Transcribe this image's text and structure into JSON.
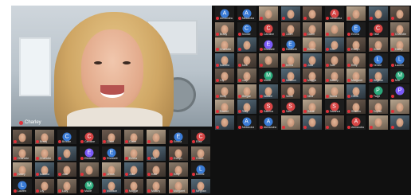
{
  "speaker": {
    "name": "Charley"
  },
  "colors": {
    "mic_muted": "#e0313a",
    "grid_bg": "#101010"
  },
  "tiles": [
    {
      "label": "Alexandra",
      "avatar": "A",
      "color": "#3a7bd5"
    },
    {
      "label": "Alexandra",
      "avatar": "A",
      "color": "#3a7bd5"
    },
    {
      "label": "",
      "avatar": "",
      "color": ""
    },
    {
      "label": "",
      "avatar": "",
      "color": ""
    },
    {
      "label": "",
      "avatar": "",
      "color": ""
    },
    {
      "label": "Alexandra",
      "avatar": "A",
      "color": "#d64545"
    },
    {
      "label": "",
      "avatar": "",
      "color": ""
    },
    {
      "label": "",
      "avatar": "",
      "color": ""
    },
    {
      "label": "",
      "avatar": "",
      "color": ""
    },
    {
      "label": "Brady",
      "avatar": "",
      "color": ""
    },
    {
      "label": "Brooke",
      "avatar": "C",
      "color": "#3a7bd5"
    },
    {
      "label": "Caroline",
      "avatar": "C",
      "color": "#d64545"
    },
    {
      "label": "Claire",
      "avatar": "",
      "color": ""
    },
    {
      "label": "Claire",
      "avatar": "",
      "color": ""
    },
    {
      "label": "",
      "avatar": "",
      "color": ""
    },
    {
      "label": "Emma",
      "avatar": "E",
      "color": "#3a7bd5"
    },
    {
      "label": "Elise",
      "avatar": "C",
      "color": "#d64545"
    },
    {
      "label": "Charlotte",
      "avatar": "",
      "color": ""
    },
    {
      "label": "Charlotte",
      "avatar": "",
      "color": ""
    },
    {
      "label": "",
      "avatar": "",
      "color": ""
    },
    {
      "label": "Elizabeth",
      "avatar": "E",
      "color": "#7a5af8"
    },
    {
      "label": "Elizabeth",
      "avatar": "E",
      "color": "#3a7bd5"
    },
    {
      "label": "Emma",
      "avatar": "",
      "color": ""
    },
    {
      "label": "Erin",
      "avatar": "",
      "color": ""
    },
    {
      "label": "Evelyn",
      "avatar": "",
      "color": ""
    },
    {
      "label": "Grace",
      "avatar": "",
      "color": ""
    },
    {
      "label": "Hailey",
      "avatar": "",
      "color": ""
    },
    {
      "label": "Isabella",
      "avatar": "",
      "color": ""
    },
    {
      "label": "Jack",
      "avatar": "",
      "color": ""
    },
    {
      "label": "",
      "avatar": "",
      "color": ""
    },
    {
      "label": "Jenna",
      "avatar": "",
      "color": ""
    },
    {
      "label": "Julia",
      "avatar": "",
      "color": ""
    },
    {
      "label": "Kate",
      "avatar": "",
      "color": ""
    },
    {
      "label": "Kelly",
      "avatar": "",
      "color": ""
    },
    {
      "label": "Kenzie",
      "avatar": "L",
      "color": "#3a7bd5"
    },
    {
      "label": "Lauren",
      "avatar": "L",
      "color": "#3a7bd5"
    },
    {
      "label": "Lily",
      "avatar": "",
      "color": ""
    },
    {
      "label": "Lucy",
      "avatar": "",
      "color": ""
    },
    {
      "label": "Macie",
      "avatar": "M",
      "color": "#2aa87a"
    },
    {
      "label": "Madison",
      "avatar": "",
      "color": ""
    },
    {
      "label": "Maggie",
      "avatar": "",
      "color": ""
    },
    {
      "label": "Mallory",
      "avatar": "",
      "color": ""
    },
    {
      "label": "Margaret",
      "avatar": "",
      "color": ""
    },
    {
      "label": "Meghan",
      "avatar": "",
      "color": ""
    },
    {
      "label": "Mia",
      "avatar": "M",
      "color": "#2aa87a"
    },
    {
      "label": "Molly",
      "avatar": "",
      "color": ""
    },
    {
      "label": "Morgan",
      "avatar": "",
      "color": ""
    },
    {
      "label": "Natalie",
      "avatar": "",
      "color": ""
    },
    {
      "label": "Nicole",
      "avatar": "",
      "color": ""
    },
    {
      "label": "Nina",
      "avatar": "",
      "color": ""
    },
    {
      "label": "Noura",
      "avatar": "",
      "color": ""
    },
    {
      "label": "Olivia",
      "avatar": "",
      "color": ""
    },
    {
      "label": "Paige",
      "avatar": "P",
      "color": "#2aa87a"
    },
    {
      "label": "",
      "avatar": "P",
      "color": "#7a5af8"
    },
    {
      "label": "Rachel",
      "avatar": "",
      "color": ""
    },
    {
      "label": "Riley",
      "avatar": "",
      "color": ""
    },
    {
      "label": "Sabrina",
      "avatar": "S",
      "color": "#d64545"
    },
    {
      "label": "Sam",
      "avatar": "S",
      "color": "#d64545"
    },
    {
      "label": "Sarah",
      "avatar": "",
      "color": ""
    },
    {
      "label": "Savanna",
      "avatar": "S",
      "color": "#d64545"
    },
    {
      "label": "Shanes",
      "avatar": "",
      "color": ""
    },
    {
      "label": "Sophia",
      "avatar": "",
      "color": ""
    },
    {
      "label": "",
      "avatar": "",
      "color": ""
    },
    {
      "label": "",
      "avatar": "",
      "color": ""
    }
  ]
}
